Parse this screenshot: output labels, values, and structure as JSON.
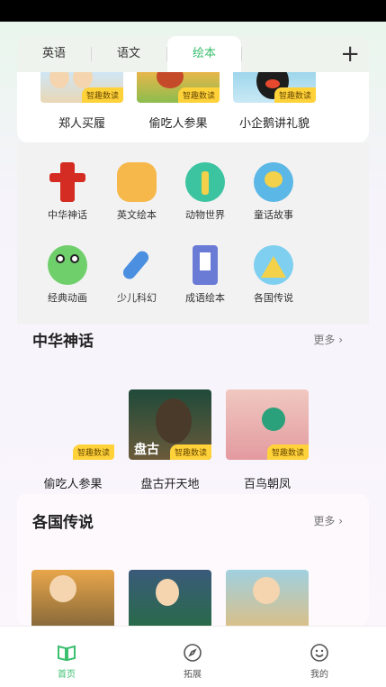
{
  "tabs": [
    {
      "label": "英语"
    },
    {
      "label": "语文"
    },
    {
      "label": "绘本"
    }
  ],
  "top_books": [
    {
      "title": "郑人买履",
      "badge": "智趣数读"
    },
    {
      "title": "偷吃人参果",
      "badge": "智趣数读"
    },
    {
      "title": "小企鹅讲礼貌",
      "badge": "智趣数读"
    }
  ],
  "categories": [
    {
      "label": "中华神话",
      "icon": "pillar-icon"
    },
    {
      "label": "英文绘本",
      "icon": "cheese-icon"
    },
    {
      "label": "动物世界",
      "icon": "giraffe-icon"
    },
    {
      "label": "童话故事",
      "icon": "unicorn-icon"
    },
    {
      "label": "经典动画",
      "icon": "frog-icon"
    },
    {
      "label": "少儿科幻",
      "icon": "rocket-icon"
    },
    {
      "label": "成语绘本",
      "icon": "book-icon"
    },
    {
      "label": "各国传说",
      "icon": "pyramid-icon"
    }
  ],
  "section1": {
    "title": "中华神话",
    "more": "更多 ›",
    "items": [
      {
        "title": "偷吃人参果",
        "badge": "智趣数读"
      },
      {
        "title": "盘古开天地",
        "badge": "智趣数读",
        "cover_text": "盘古"
      },
      {
        "title": "百鸟朝凤",
        "badge": "智趣数读"
      }
    ]
  },
  "section2": {
    "title": "各国传说",
    "more": "更多 ›"
  },
  "nav": [
    {
      "label": "首页"
    },
    {
      "label": "拓展"
    },
    {
      "label": "我的"
    }
  ],
  "colors": {
    "accent": "#3cbf6f",
    "badge": "#ffd23a"
  }
}
